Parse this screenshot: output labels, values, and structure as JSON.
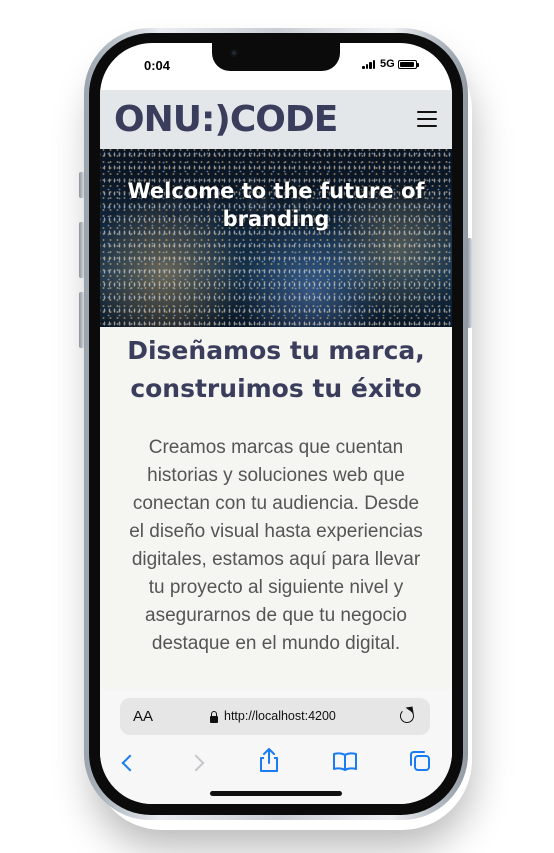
{
  "status_bar": {
    "time": "0:04",
    "network": "5G"
  },
  "site": {
    "logo": "ONU:)CODE",
    "hero_title": "Welcome to the future of branding",
    "headline": "Diseñamos tu marca, construimos tu éxito",
    "body": "Creamos marcas que cuentan historias y soluciones web que conectan con tu audiencia. Desde el diseño visual hasta experiencias digitales, estamos aquí para llevar tu proyecto al siguiente nivel y asegurarnos de que tu negocio destaque en el mundo digital."
  },
  "browser": {
    "text_size_label": "AA",
    "url": "http://localhost:4200"
  },
  "colors": {
    "brand": "#3a3d5c",
    "toolbar_accent": "#1a7cf5",
    "content_bg": "#f5f5f1",
    "navbar_bg": "#e4e7ea"
  },
  "icons": [
    "menu-icon",
    "lock-icon",
    "reload-icon",
    "back-icon",
    "forward-icon",
    "share-icon",
    "bookmarks-icon",
    "tabs-icon"
  ]
}
